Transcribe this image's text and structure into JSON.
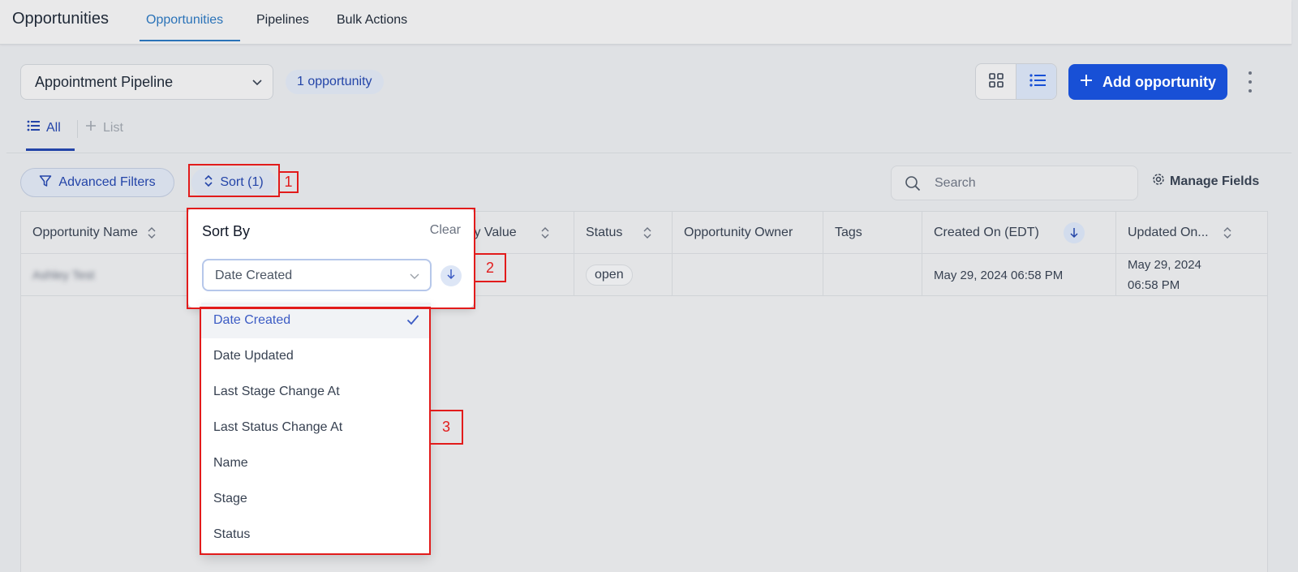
{
  "topbar": {
    "title": "Opportunities",
    "tabs": [
      {
        "label": "Opportunities",
        "active": true
      },
      {
        "label": "Pipelines",
        "active": false
      },
      {
        "label": "Bulk Actions",
        "active": false
      }
    ]
  },
  "pipeline": {
    "selected": "Appointment Pipeline",
    "count_label": "1 opportunity"
  },
  "toolbar": {
    "add_label": "Add opportunity"
  },
  "list_tabs": {
    "all_label": "All",
    "add_label": "List"
  },
  "filters": {
    "advanced_label": "Advanced Filters",
    "sort_label": "Sort (1)",
    "search_placeholder": "Search",
    "manage_label": "Manage Fields"
  },
  "table": {
    "columns": [
      "Opportunity Name",
      "ty Value",
      "Status",
      "Opportunity Owner",
      "Tags",
      "Created On (EDT)",
      "Updated On..."
    ],
    "rows": [
      {
        "name": "Ashley Test",
        "status": "open",
        "owner": "",
        "tags": "",
        "created": "May 29, 2024 06:58 PM",
        "updated_line1": "May 29, 2024",
        "updated_line2": "06:58 PM"
      }
    ]
  },
  "sort_popover": {
    "title": "Sort By",
    "clear_label": "Clear",
    "selected": "Date Created",
    "options": [
      "Date Created",
      "Date Updated",
      "Last Stage Change At",
      "Last Status Change At",
      "Name",
      "Stage",
      "Status"
    ]
  },
  "annotations": [
    "1",
    "2",
    "3"
  ],
  "colors": {
    "accent": "#1850d6",
    "link": "#2344a8",
    "tab_active": "#2b73b8",
    "annotation": "#e21b1b"
  }
}
